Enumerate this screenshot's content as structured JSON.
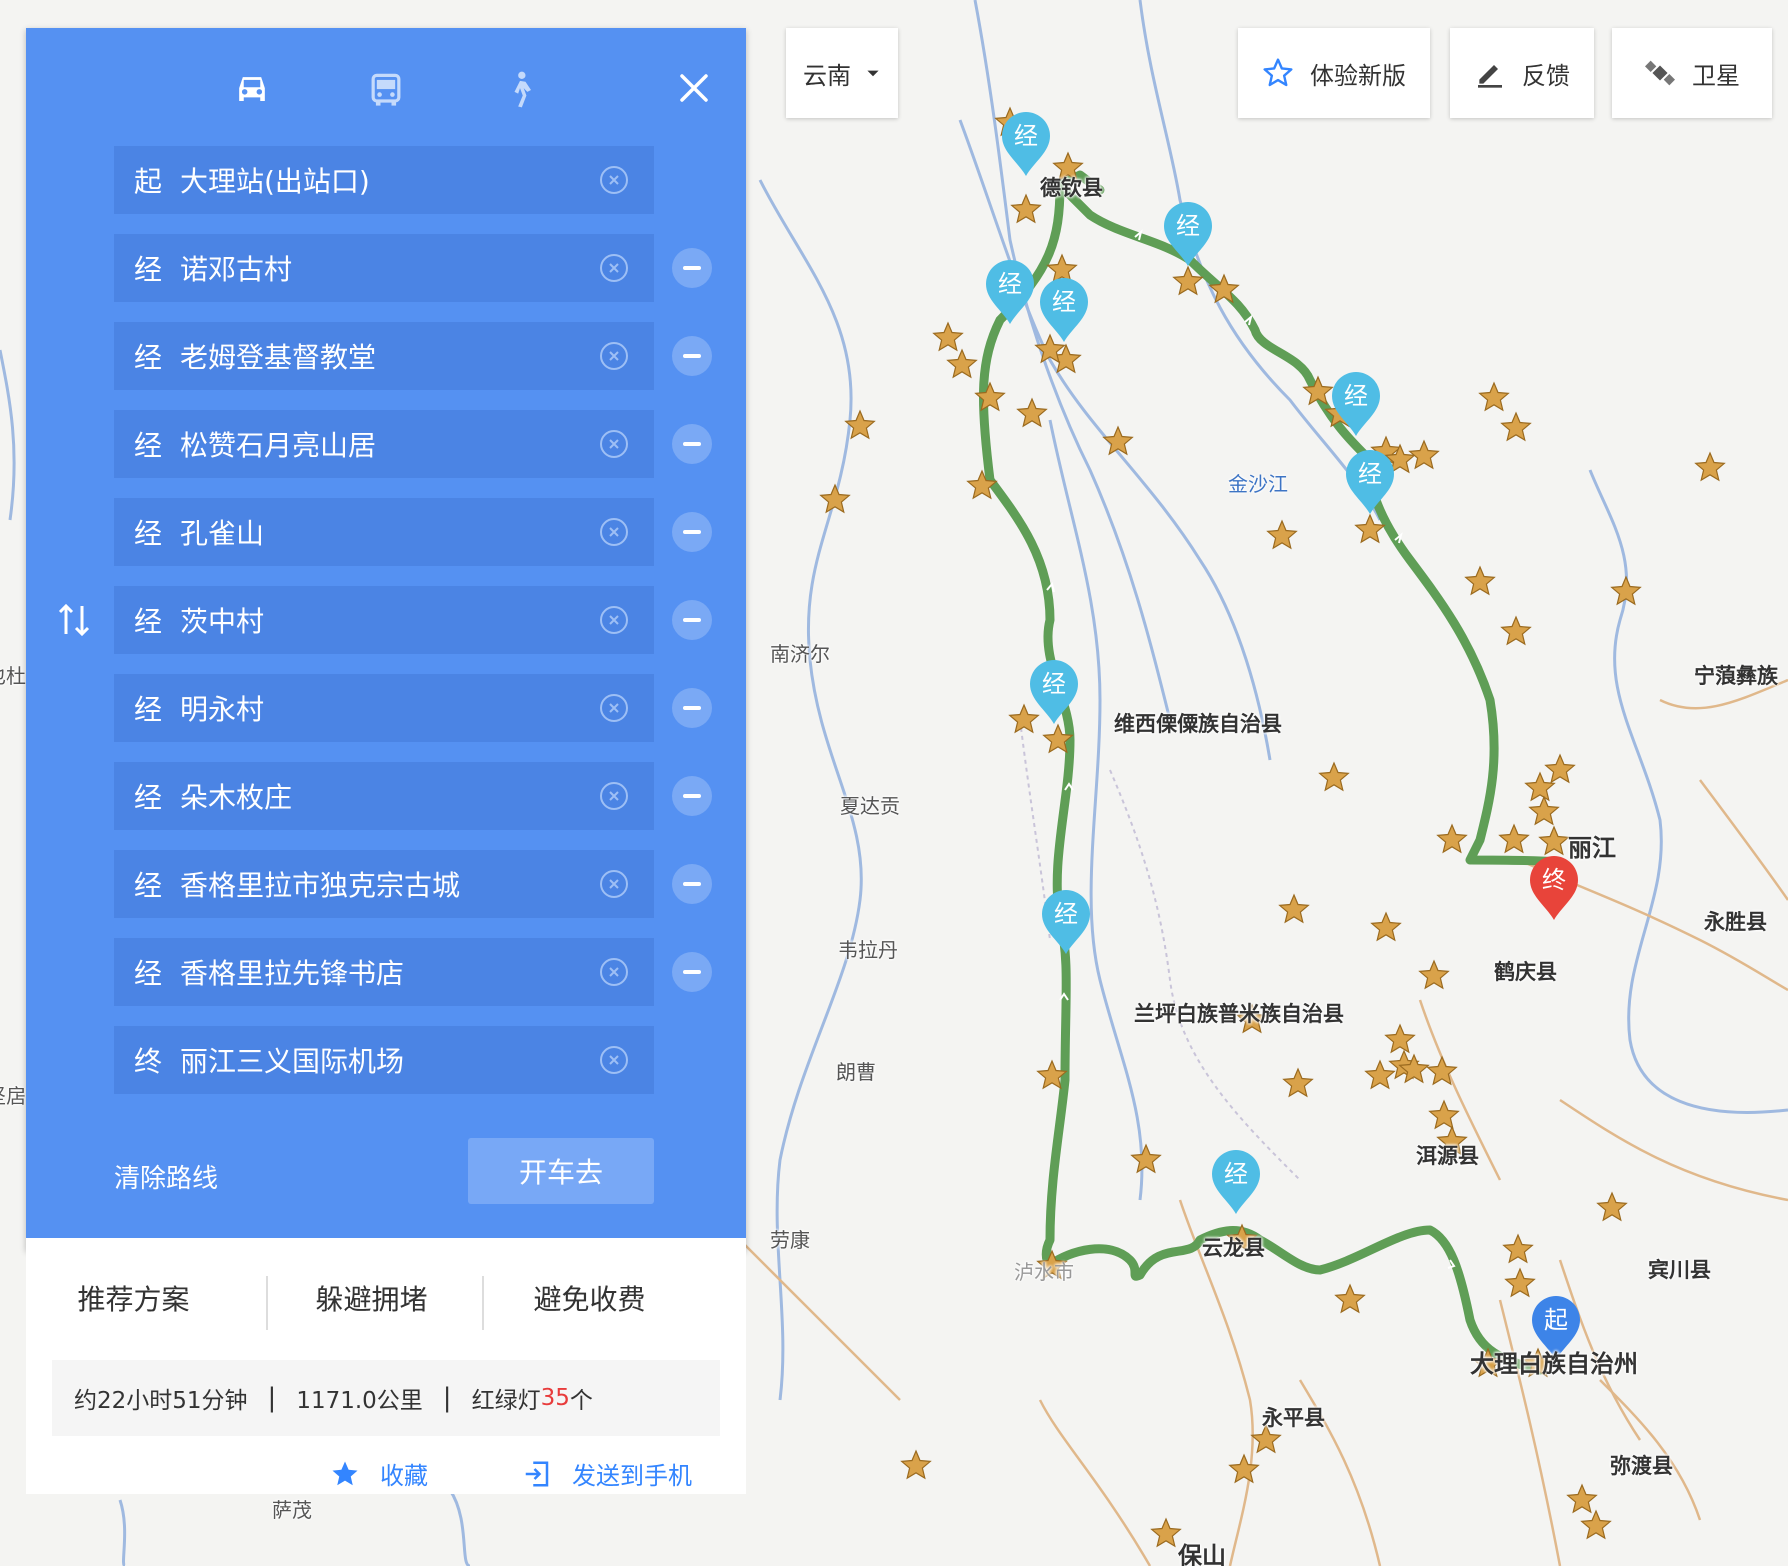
{
  "route_panel": {
    "modes": [
      {
        "name": "drive",
        "icon": "car-icon",
        "active": true
      },
      {
        "name": "transit",
        "icon": "bus-icon",
        "active": false
      },
      {
        "name": "walk",
        "icon": "walk-icon",
        "active": false
      }
    ],
    "stops": [
      {
        "tag": "起",
        "name": "大理站(出站口)",
        "removable": false
      },
      {
        "tag": "经",
        "name": "诺邓古村",
        "removable": true
      },
      {
        "tag": "经",
        "name": "老姆登基督教堂",
        "removable": true
      },
      {
        "tag": "经",
        "name": "松赞石月亮山居",
        "removable": true
      },
      {
        "tag": "经",
        "name": "孔雀山",
        "removable": true
      },
      {
        "tag": "经",
        "name": "茨中村",
        "removable": true
      },
      {
        "tag": "经",
        "name": "明永村",
        "removable": true
      },
      {
        "tag": "经",
        "name": "朵木枚庄",
        "removable": true
      },
      {
        "tag": "经",
        "name": "香格里拉市独克宗古城",
        "removable": true
      },
      {
        "tag": "经",
        "name": "香格里拉先锋书店",
        "removable": true
      },
      {
        "tag": "终",
        "name": "丽江三义国际机场",
        "removable": false
      }
    ],
    "clear_route_label": "清除路线",
    "go_button_label": "开车去",
    "options": [
      "推荐方案",
      "躲避拥堵",
      "避免收费"
    ],
    "summary": {
      "duration": "约22小时51分钟",
      "distance": "1171.0公里",
      "lights_prefix": "红绿灯",
      "lights_count": "35",
      "lights_suffix": "个"
    },
    "favorite_label": "收藏",
    "send_label": "发送到手机"
  },
  "toolbar": {
    "region": "云南",
    "new_version": "体验新版",
    "feedback": "反馈",
    "satellite": "卫星"
  },
  "map": {
    "labels": {
      "jinshajiang": "金沙江",
      "nanjier": "南济尔",
      "weixi": "维西傈僳族自治县",
      "xiadagong": "夏达贡",
      "weiladan": "韦拉丹",
      "langcao": "朗曹",
      "laokang": "劳康",
      "lanping": "兰坪白族普米族自治县",
      "lijiang": "丽江",
      "heqing": "鹤庆县",
      "yongsheng": "永胜县",
      "ninglang": "宁蒗彝族",
      "eryuan": "洱源县",
      "yunlong": "云龙县",
      "lushui": "泸水市",
      "binchuan": "宾川县",
      "dali": "大理白族自治州",
      "yongping": "永平县",
      "midu": "弥渡县",
      "baoshan": "保山",
      "samao": "萨茂",
      "deqin": "德钦县",
      "left_cut1": "也杜",
      "left_cut2": "坚扂"
    },
    "waypoint_marker_text": "经",
    "start_marker_text": "起",
    "end_marker_text": "终",
    "colors": {
      "route": "#5f9e56",
      "waypoint": "#4fbde5",
      "start": "#3d84e8",
      "end": "#e8443a",
      "star": "#d9a24a"
    }
  }
}
